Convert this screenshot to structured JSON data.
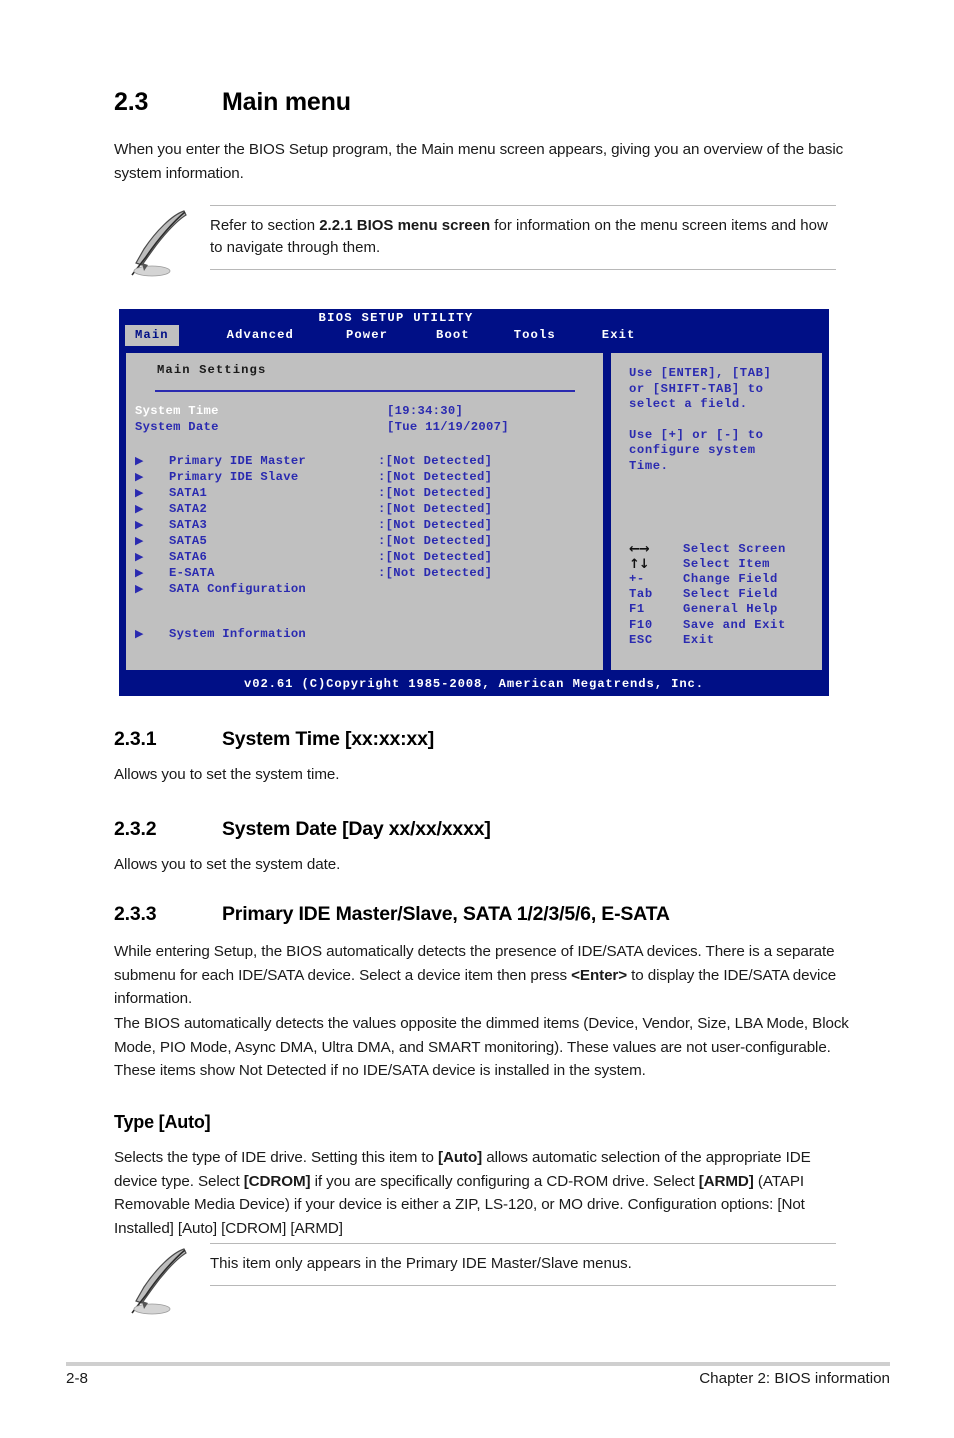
{
  "section": {
    "number": "2.3",
    "title": "Main menu",
    "intro": "When you enter the BIOS Setup program, the Main menu screen appears, giving you an overview of the basic system information."
  },
  "note_top": {
    "icon": "quill-note-icon",
    "text_part1": "Refer to section ",
    "text_bold": "2.2.1 BIOS menu screen",
    "text_part2": " for information on the menu screen items and how to navigate through them."
  },
  "bios": {
    "title": "BIOS SETUP UTILITY",
    "tabs": [
      {
        "label": "Main",
        "active": true
      },
      {
        "label": "Advanced",
        "active": false
      },
      {
        "label": "Power",
        "active": false
      },
      {
        "label": "Boot",
        "active": false
      },
      {
        "label": "Tools",
        "active": false
      },
      {
        "label": "Exit",
        "active": false
      }
    ],
    "panel_header": "Main Settings",
    "fields": [
      {
        "label": "System Time",
        "value": "[19:34:30]",
        "selected": true
      },
      {
        "label": "System Date",
        "value": "[Tue 11/19/2007]",
        "selected": false
      }
    ],
    "devices": [
      {
        "arrow": "triangle-right-icon",
        "name": "Primary IDE Master",
        "value": ":[Not Detected]"
      },
      {
        "arrow": "triangle-right-icon",
        "name": "Primary IDE Slave",
        "value": ":[Not Detected]"
      },
      {
        "arrow": "triangle-right-icon",
        "name": "SATA1",
        "value": ":[Not Detected]"
      },
      {
        "arrow": "triangle-right-icon",
        "name": "SATA2",
        "value": ":[Not Detected]"
      },
      {
        "arrow": "triangle-right-icon",
        "name": "SATA3",
        "value": ":[Not Detected]"
      },
      {
        "arrow": "triangle-right-icon",
        "name": "SATA5",
        "value": ":[Not Detected]"
      },
      {
        "arrow": "triangle-right-icon",
        "name": "SATA6",
        "value": ":[Not Detected]"
      },
      {
        "arrow": "triangle-right-icon",
        "name": "E-SATA",
        "value": ":[Not Detected]"
      },
      {
        "arrow": "triangle-right-icon",
        "name": "SATA Configuration",
        "value": ""
      }
    ],
    "devices_extra": [
      {
        "arrow": "triangle-right-icon",
        "name": "System Information",
        "value": ""
      }
    ],
    "help_line1": "Use [ENTER], [TAB]",
    "help_line2": "or [SHIFT-TAB] to",
    "help_line3": "select a field.",
    "help_line4": "Use [+] or [-] to",
    "help_line5": "configure system",
    "help_line6": "Time.",
    "keys": [
      {
        "key": "←→",
        "glyph": true,
        "desc": "Select Screen"
      },
      {
        "key": "↑↓",
        "glyph": true,
        "desc": "Select Item"
      },
      {
        "key": "+-",
        "glyph": false,
        "desc": "Change Field"
      },
      {
        "key": "Tab",
        "glyph": false,
        "desc": "Select Field"
      },
      {
        "key": "F1",
        "glyph": false,
        "desc": "General Help"
      },
      {
        "key": "F10",
        "glyph": false,
        "desc": "Save and Exit"
      },
      {
        "key": "ESC",
        "glyph": false,
        "desc": "Exit"
      }
    ],
    "footer": "v02.61 (C)Copyright 1985-2008, American Megatrends, Inc.",
    "colors": {
      "bg_blue": "#000f86",
      "panel_gray": "#c0c0c0",
      "text_blue": "#2a2ab0",
      "selected_white": "#ffffff"
    }
  },
  "sub231": {
    "number": "2.3.1",
    "title": "System Time [xx:xx:xx]",
    "body": "Allows you to set the system time."
  },
  "sub232": {
    "number": "2.3.2",
    "title": "System Date [Day xx/xx/xxxx]",
    "body": "Allows you to set the system date."
  },
  "sub233": {
    "number": "2.3.3",
    "title": "Primary IDE Master/Slave, SATA 1/2/3/5/6, E-SATA",
    "para1_a": "While entering Setup, the BIOS automatically detects the presence of IDE/SATA devices. There is a separate submenu for each IDE/SATA device. Select a device item then press ",
    "para1_bold": "<Enter>",
    "para1_b": " to display the IDE/SATA device information.",
    "para2": "The BIOS automatically detects the values opposite the dimmed items (Device, Vendor, Size, LBA Mode, Block Mode, PIO Mode, Async DMA, Ultra DMA, and SMART monitoring). These values are not user-configurable. These items show Not Detected if no IDE/SATA device is installed in the system."
  },
  "type_auto": {
    "title": "Type [Auto]",
    "t1": "Selects the type of IDE drive. Setting this item to ",
    "b1": "[Auto]",
    "t2": " allows automatic selection of the appropriate IDE device type. Select ",
    "b2": "[CDROM]",
    "t3": " if you are specifically configuring a CD-ROM drive. Select ",
    "b3": "[ARMD]",
    "t4": " (ATAPI Removable Media Device) if your device is either a ZIP, LS-120, or MO drive. Configuration options: [Not Installed] [Auto] [CDROM] [ARMD]"
  },
  "note_bottom": {
    "icon": "quill-note-icon",
    "text": "This item only appears in the Primary IDE Master/Slave menus."
  },
  "footer": {
    "page_number": "2-8",
    "chapter": "Chapter 2: BIOS information"
  }
}
